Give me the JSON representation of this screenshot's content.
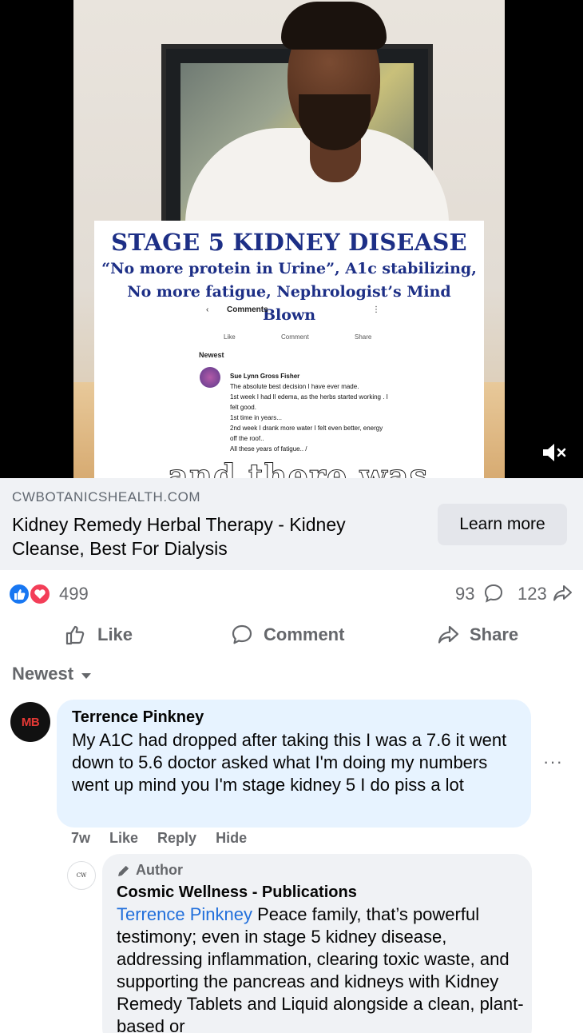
{
  "video": {
    "overlay_title": "STAGE 5 KIDNEY DISEASE",
    "overlay_subtitle": "“No more protein in Urine”, A1c stabilizing, No more fatigue, Nephrologist’s Mind Blown",
    "embedded_screenshot": {
      "header": "Comments",
      "like": "Like",
      "comment": "Comment",
      "share": "Share",
      "sort": "Newest",
      "commenter": "Sue Lynn Gross Fisher",
      "comment_lines": [
        "The absolute best decision I have ever made.",
        "1st week I had ll edema, as the herbs started working . I felt good.",
        "1st time in years...",
        "2nd week I drank more water I felt even better, energy off the roof..",
        "All these years of fatigue.. /"
      ]
    },
    "caption": "and there was",
    "mute_icon": "speaker-muted-icon"
  },
  "ad": {
    "domain": "CWBOTANICSHEALTH.COM",
    "title": "Kidney Remedy Herbal Therapy - Kidney Cleanse, Best For Dialysis",
    "cta": "Learn more"
  },
  "stats": {
    "reactions": "499",
    "comments": "93",
    "shares": "123",
    "colors": {
      "like": "#1877f2",
      "love": "#f33e58"
    }
  },
  "actions": {
    "like": "Like",
    "comment": "Comment",
    "share": "Share"
  },
  "comments": {
    "sort_label": "Newest",
    "items": [
      {
        "avatar_text": "MB",
        "name": "Terrence Pinkney",
        "text": "My A1C had dropped after taking this I was a 7.6 it went down to 5.6 doctor asked what I'm doing my numbers went up mind you I'm stage kidney 5 I do piss a lot",
        "time": "7w",
        "like": "Like",
        "reply": "Reply",
        "hide": "Hide",
        "more": "···"
      },
      {
        "avatar_text": "COSMIC WELLNESS",
        "badge": "Author",
        "name": "Cosmic Wellness - Publications",
        "mention": "Terrence Pinkney",
        "text": "Peace family, that’s powerful testimony; even in stage 5 kidney disease, addressing inflammation, clearing toxic waste, and supporting the pancreas and kidneys with Kidney Remedy Tablets and Liquid alongside a clean, plant-based or"
      }
    ]
  }
}
